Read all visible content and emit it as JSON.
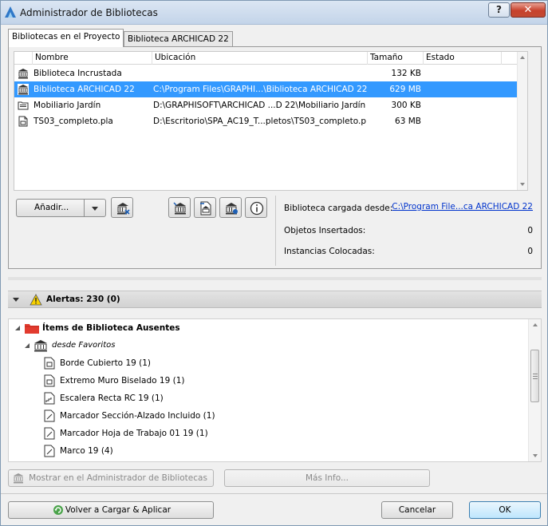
{
  "window": {
    "title": "Administrador de Bibliotecas",
    "help_label": "?",
    "close_label": "✕"
  },
  "tabs": [
    {
      "label": "Bibliotecas en el Proyecto",
      "active": true
    },
    {
      "label": "Biblioteca ARCHICAD 22",
      "active": false
    }
  ],
  "library_list": {
    "columns": [
      "Nombre",
      "Ubicación",
      "Tamaño",
      "Estado"
    ],
    "rows": [
      {
        "name": "Biblioteca Incrustada",
        "location": "",
        "size": "132 KB",
        "status": "",
        "selected": false
      },
      {
        "name": "Biblioteca ARCHICAD 22",
        "location": "C:\\Program Files\\GRAPHI...\\Biblioteca ARCHICAD 22",
        "size": "629 MB",
        "status": "",
        "selected": true
      },
      {
        "name": "Mobiliario Jardín",
        "location": "D:\\GRAPHISOFT\\ARCHICAD ...D 22\\Mobiliario Jardín",
        "size": "300 KB",
        "status": "",
        "selected": false
      },
      {
        "name": "TS03_completo.pla",
        "location": "D:\\Escritorio\\SPA_AC19_T...pletos\\TS03_completo.pla",
        "size": "63 MB",
        "status": "",
        "selected": false
      }
    ]
  },
  "toolbar": {
    "add_label": "Añadir...",
    "icons": [
      "library-remove-icon",
      "library-bim-server-icon",
      "library-export-icon",
      "library-settings-icon",
      "info-icon"
    ]
  },
  "details": {
    "loaded_from_label": "Biblioteca cargada desde:",
    "loaded_from_value": "C:\\Program File...ca ARCHICAD 22",
    "inserted_label": "Objetos Insertados:",
    "inserted_value": "0",
    "placed_label": "Instancias Colocadas:",
    "placed_value": "0"
  },
  "alerts": {
    "header": "Alertas: 230 (0)",
    "group_title": "Ítems de Biblioteca Ausentes",
    "subgroup": "desde Favoritos",
    "items": [
      "Borde Cubierto 19 (1)",
      "Extremo Muro Biselado 19 (1)",
      "Escalera Recta RC 19 (1)",
      "Marcador Sección-Alzado Incluido (1)",
      "Marcador Hoja de Trabajo 01 19 (1)",
      "Marco 19 (4)"
    ],
    "show_in_manager_label": "Mostrar en el Administrador de Bibliotecas",
    "more_info_label": "Más Info..."
  },
  "footer": {
    "reload_label": "Volver a Cargar & Aplicar",
    "cancel_label": "Cancelar",
    "ok_label": "OK"
  },
  "colors": {
    "selection": "#3399ff",
    "folder_red": "#e23b2e",
    "link": "#0033cc",
    "warning": "#f6d000"
  }
}
